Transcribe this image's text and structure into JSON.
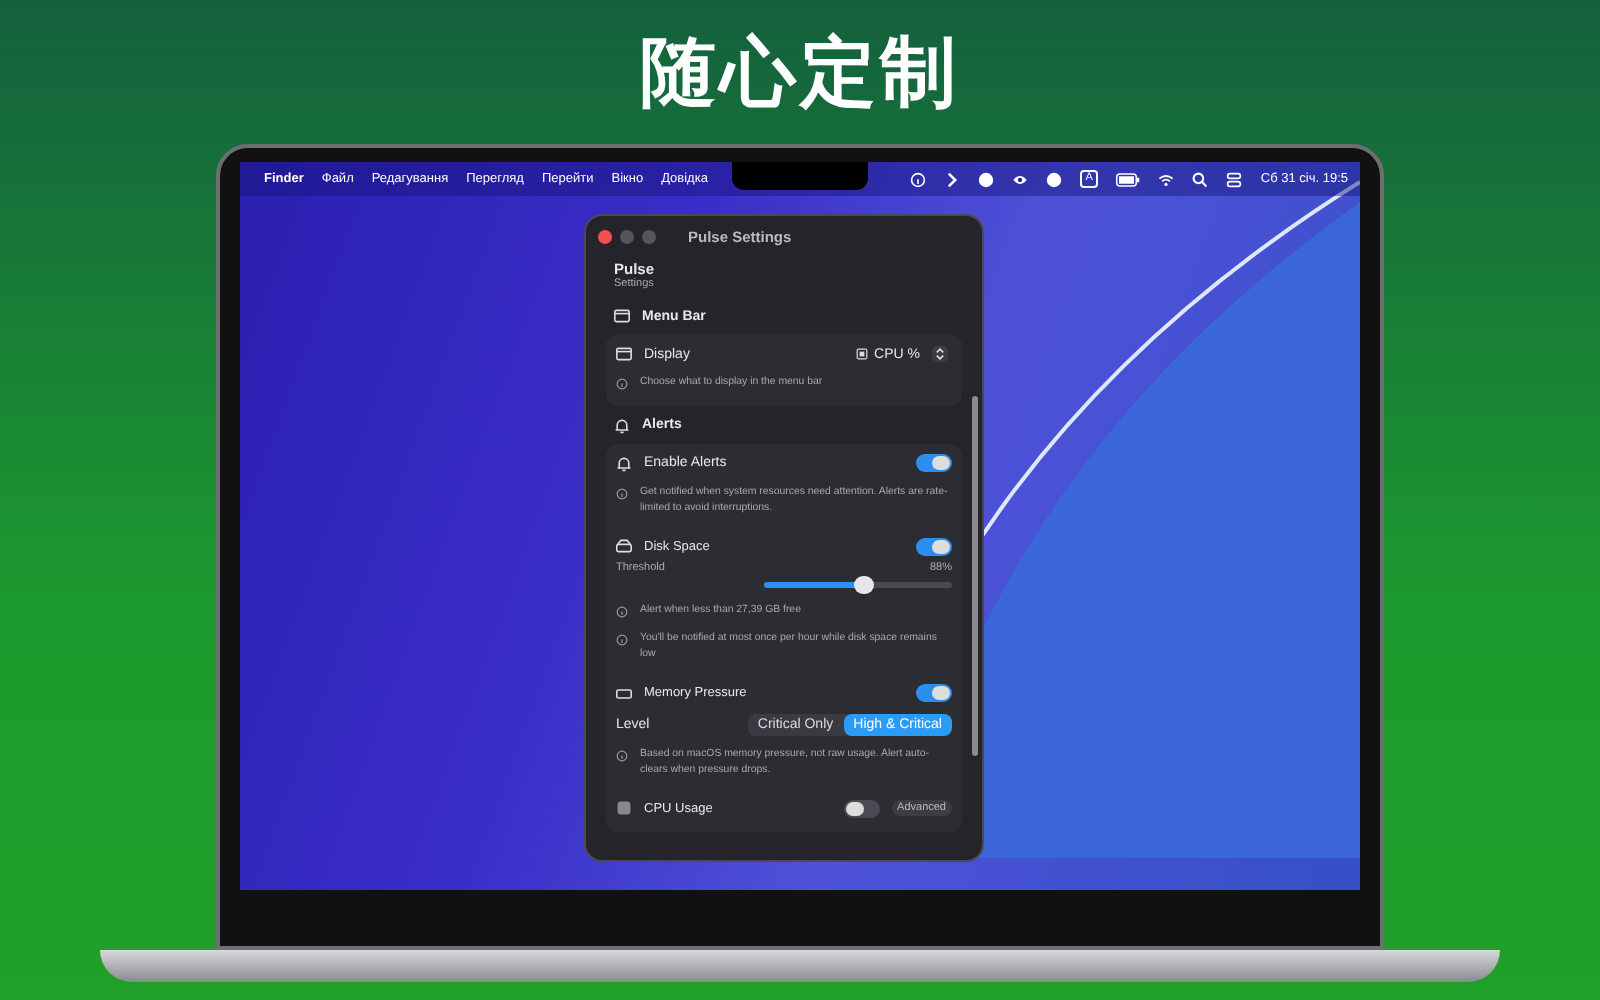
{
  "headline": "随心定制",
  "menu_bar": {
    "app": "Finder",
    "items": [
      "Файл",
      "Редагування",
      "Перегляд",
      "Перейти",
      "Вікно",
      "Довідка"
    ],
    "input_source": "A",
    "clock": "Сб 31 січ. 19:5"
  },
  "window": {
    "title": "Pulse Settings",
    "app_name": "Pulse",
    "subtitle": "Settings",
    "sections": [
      {
        "title": "Menu Bar",
        "rows": [
          {
            "kind": "select",
            "label": "Display",
            "value": "CPU %"
          },
          {
            "kind": "note",
            "text": "Choose what to display in the menu bar"
          }
        ]
      },
      {
        "title": "Alerts",
        "rows": [
          {
            "kind": "toggle",
            "label": "Enable Alerts",
            "on": true
          },
          {
            "kind": "note",
            "text": "Get notified when system resources need attention. Alerts are rate-limited to avoid interruptions."
          },
          {
            "kind": "subtoggle",
            "label": "Disk Space",
            "on": true
          },
          {
            "kind": "slider",
            "label": "Threshold",
            "reading": "88%",
            "level": 0.53
          },
          {
            "kind": "note",
            "text": "Alert when less than 27,39 GB free"
          },
          {
            "kind": "note",
            "text": "You'll be notified at most once per hour while disk space remains low"
          },
          {
            "kind": "subtoggle",
            "label": "Memory Pressure",
            "on": true
          },
          {
            "kind": "segmented",
            "label": "Level",
            "options": [
              {
                "label": "Critical Only",
                "selected": false
              },
              {
                "label": "High & Critical",
                "selected": true
              }
            ]
          },
          {
            "kind": "note",
            "text": "Based on macOS memory pressure, not raw usage. Alert auto-clears when pressure drops."
          },
          {
            "kind": "subtoggle",
            "label": "CPU Usage",
            "on": false,
            "badge": "Advanced"
          }
        ]
      }
    ]
  }
}
